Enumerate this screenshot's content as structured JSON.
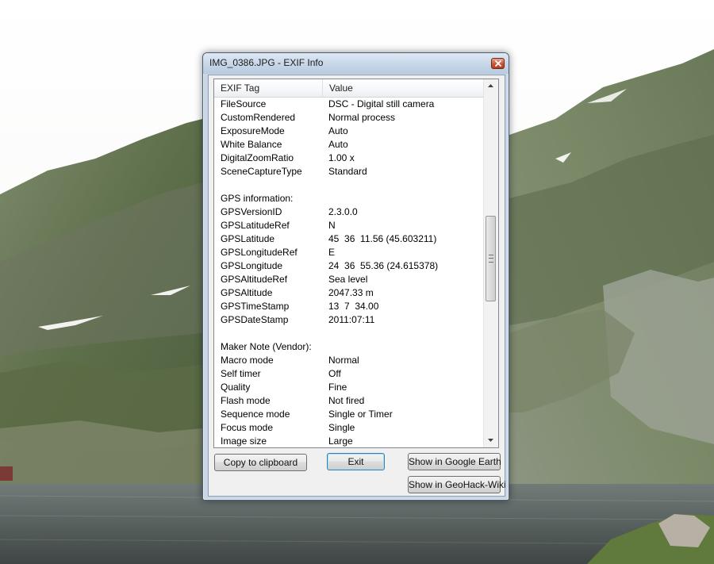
{
  "window": {
    "title": "IMG_0386.JPG - EXIF Info"
  },
  "list": {
    "columns": [
      "EXIF Tag",
      "Value"
    ],
    "rows": [
      [
        "FileSource",
        "DSC - Digital still camera"
      ],
      [
        "CustomRendered",
        "Normal process"
      ],
      [
        "ExposureMode",
        "Auto"
      ],
      [
        "White Balance",
        "Auto"
      ],
      [
        "DigitalZoomRatio",
        "1.00 x"
      ],
      [
        "SceneCaptureType",
        "Standard"
      ],
      [
        "",
        ""
      ],
      [
        "GPS information:",
        ""
      ],
      [
        "GPSVersionID",
        "2.3.0.0"
      ],
      [
        "GPSLatitudeRef",
        "N"
      ],
      [
        "GPSLatitude",
        "45  36  11.56 (45.603211)"
      ],
      [
        "GPSLongitudeRef",
        "E"
      ],
      [
        "GPSLongitude",
        "24  36  55.36 (24.615378)"
      ],
      [
        "GPSAltitudeRef",
        "Sea level"
      ],
      [
        "GPSAltitude",
        "2047.33 m"
      ],
      [
        "GPSTimeStamp",
        "13  7  34.00"
      ],
      [
        "GPSDateStamp",
        "2011:07:11"
      ],
      [
        "",
        ""
      ],
      [
        "Maker Note (Vendor):",
        ""
      ],
      [
        "Macro mode",
        "Normal"
      ],
      [
        "Self timer",
        "Off"
      ],
      [
        "Quality",
        "Fine"
      ],
      [
        "Flash mode",
        "Not fired"
      ],
      [
        "Sequence mode",
        "Single or Timer"
      ],
      [
        "Focus mode",
        "Single"
      ],
      [
        "Image size",
        "Large"
      ]
    ]
  },
  "buttons": {
    "copy": "Copy to clipboard",
    "exit": "Exit",
    "google_earth": "Show in Google Earth",
    "geohack": "Show in GeoHack-Wiki"
  },
  "icons": {
    "close": "close-icon",
    "scroll_up": "scroll-up-arrow-icon",
    "scroll_down": "scroll-down-arrow-icon"
  },
  "colors": {
    "window_frame": "#c7d7e8",
    "close_button": "#cf5a3d",
    "default_button_border": "#3c7fb1"
  }
}
